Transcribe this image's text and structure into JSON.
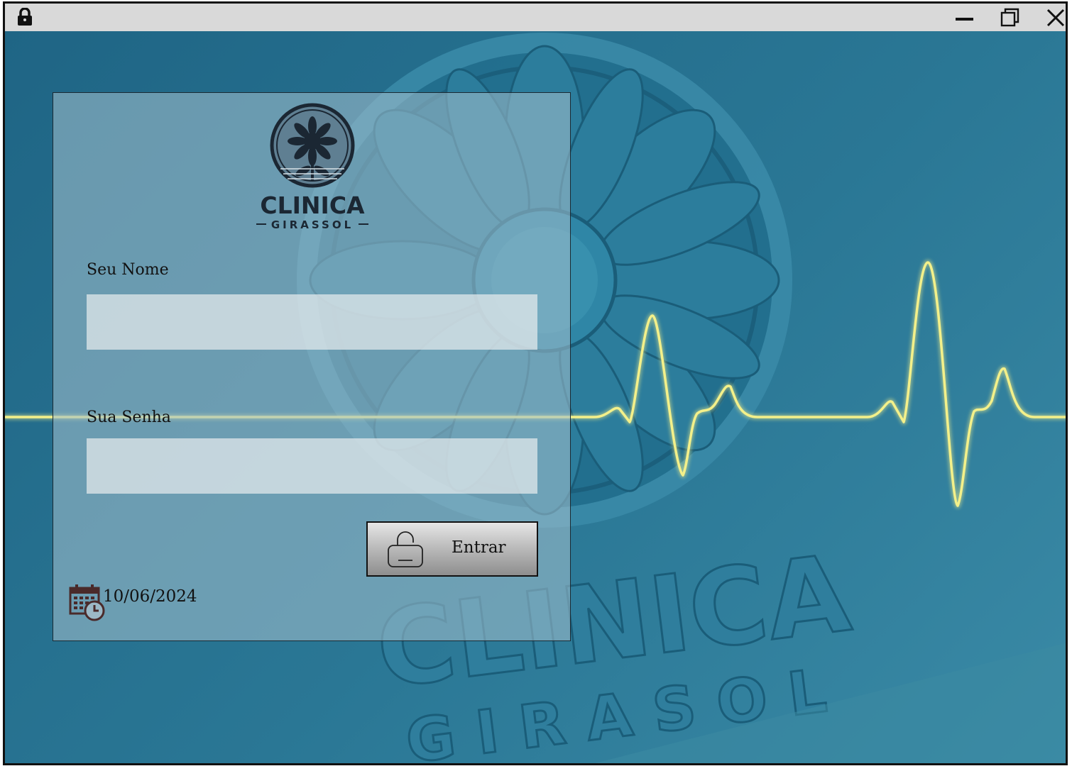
{
  "window": {
    "title_icon": "lock-icon",
    "controls": [
      "minimize-icon",
      "maximize-icon",
      "close-icon"
    ]
  },
  "background": {
    "brand_line1": "CLINICA",
    "brand_line2": "GIRASOL",
    "accent_color": "#f3f08a",
    "bg_color": "#1d6887"
  },
  "logo": {
    "line1": "CLINICA",
    "line2": "GIRASSOL"
  },
  "form": {
    "name_label": "Seu Nome",
    "name_value": "",
    "password_label": "Sua Senha",
    "password_value": "",
    "submit_label": "Entrar",
    "submit_icon": "unlock-icon"
  },
  "footer": {
    "date_icon": "calendar-clock-icon",
    "date": "10/06/2024"
  }
}
